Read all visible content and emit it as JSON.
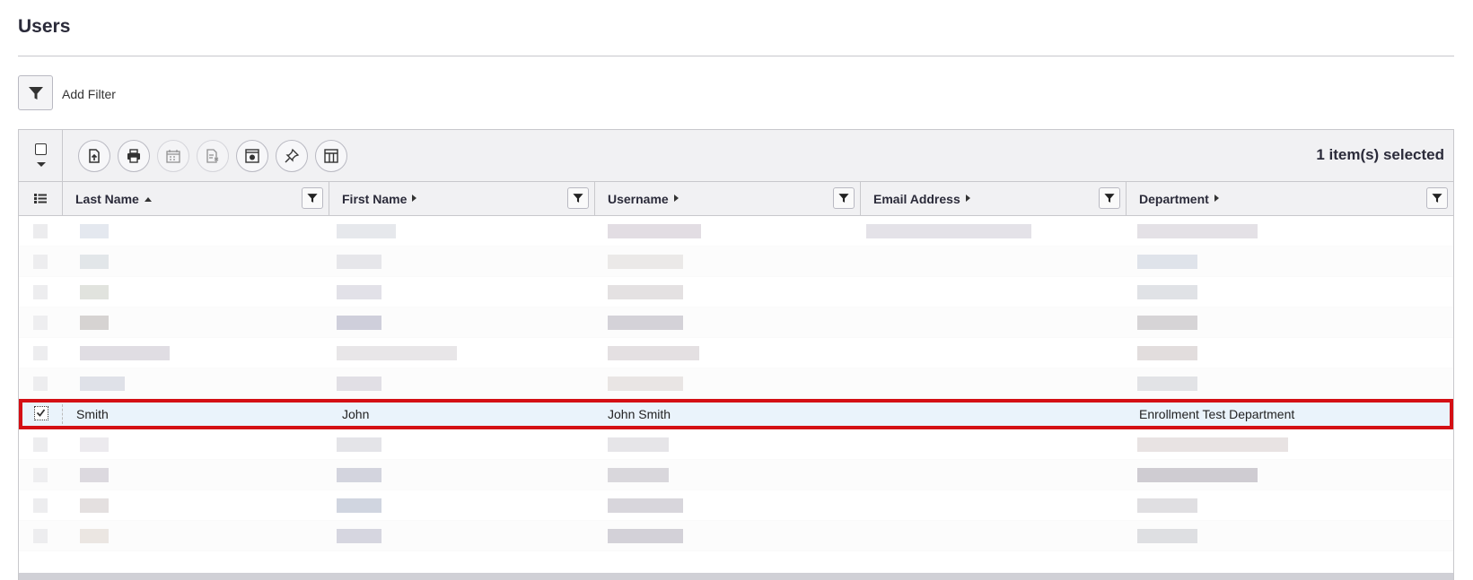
{
  "page": {
    "title": "Users"
  },
  "filter": {
    "add_label": "Add Filter"
  },
  "toolbar": {
    "selected_text": "1 item(s) selected",
    "buttons": [
      {
        "name": "export-icon",
        "disabled": false
      },
      {
        "name": "print-icon",
        "disabled": false
      },
      {
        "name": "calendar-icon",
        "disabled": true
      },
      {
        "name": "report-icon",
        "disabled": true
      },
      {
        "name": "scheduler-icon",
        "disabled": false
      },
      {
        "name": "pin-icon",
        "disabled": false
      },
      {
        "name": "columns-icon",
        "disabled": false
      }
    ]
  },
  "columns": [
    {
      "label": "Last Name",
      "sort": "asc"
    },
    {
      "label": "First Name",
      "sort": "none"
    },
    {
      "label": "Username",
      "sort": "none"
    },
    {
      "label": "Email Address",
      "sort": "none"
    },
    {
      "label": "Department",
      "sort": "none"
    }
  ],
  "selected_row": {
    "last_name": "Smith",
    "first_name": "John",
    "username": "John Smith",
    "email": "",
    "department": "Enrollment Test Department"
  },
  "colors": {
    "accent_selected_border": "#d40f14",
    "selected_row_bg": "#eaf3fb",
    "header_bg": "#f1f1f3",
    "text_dark": "#2b2b3a"
  }
}
